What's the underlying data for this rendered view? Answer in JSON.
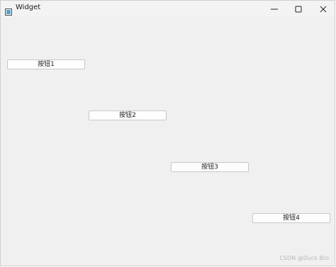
{
  "window": {
    "title": "Widget",
    "controls": {
      "minimize_icon": "minimize-icon",
      "maximize_icon": "maximize-icon",
      "close_icon": "close-icon"
    }
  },
  "buttons": [
    {
      "label": "按钮1"
    },
    {
      "label": "按钮2"
    },
    {
      "label": "按钮3"
    },
    {
      "label": "按钮4"
    }
  ],
  "watermark": "CSDN @Duck Bro"
}
